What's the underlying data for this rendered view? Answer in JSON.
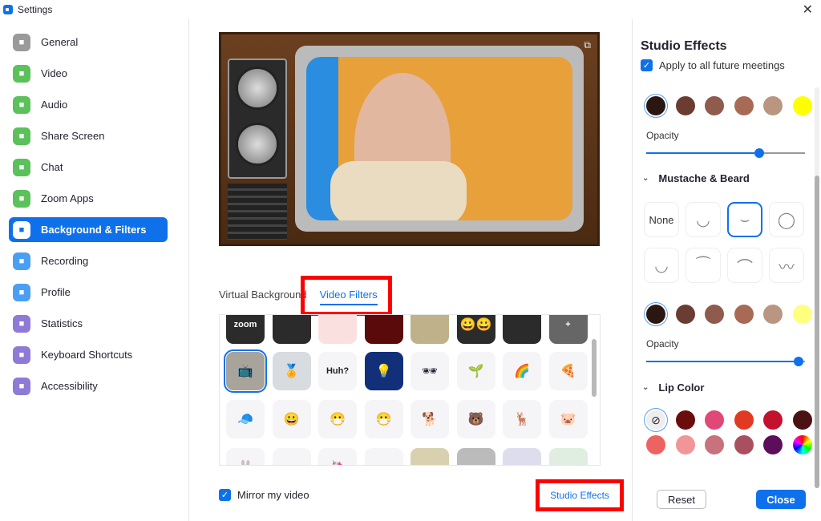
{
  "window": {
    "title": "Settings"
  },
  "sidebar": {
    "items": [
      {
        "label": "General",
        "icon": "gear-icon",
        "color": "#9a9a9a"
      },
      {
        "label": "Video",
        "icon": "video-icon",
        "color": "#5bc15b"
      },
      {
        "label": "Audio",
        "icon": "headphones-icon",
        "color": "#5bc15b"
      },
      {
        "label": "Share Screen",
        "icon": "share-screen-icon",
        "color": "#5bc15b"
      },
      {
        "label": "Chat",
        "icon": "chat-icon",
        "color": "#5bc15b"
      },
      {
        "label": "Zoom Apps",
        "icon": "apps-icon",
        "color": "#5bc15b"
      },
      {
        "label": "Background & Filters",
        "icon": "background-icon",
        "color": "#0e71eb",
        "active": true
      },
      {
        "label": "Recording",
        "icon": "recording-icon",
        "color": "#4a9ff5"
      },
      {
        "label": "Profile",
        "icon": "profile-icon",
        "color": "#4a9ff5"
      },
      {
        "label": "Statistics",
        "icon": "statistics-icon",
        "color": "#8f7ad8"
      },
      {
        "label": "Keyboard Shortcuts",
        "icon": "keyboard-icon",
        "color": "#8f7ad8"
      },
      {
        "label": "Accessibility",
        "icon": "accessibility-icon",
        "color": "#8f7ad8"
      }
    ]
  },
  "main": {
    "tabs": [
      {
        "label": "Virtual Background",
        "active": false
      },
      {
        "label": "Video Filters",
        "active": true
      }
    ],
    "filters": [
      [
        "zoom",
        "",
        "",
        "",
        "",
        "😀😀",
        "",
        "+"
      ],
      [
        "📺",
        "🏅",
        "Huh?",
        "💡",
        "🕶",
        "🌱",
        "🌈",
        "🍕"
      ],
      [
        "🧢",
        "😀",
        "😷",
        "😷",
        "🐕",
        "🐻",
        "🦌",
        "🐷"
      ],
      [
        "🐰",
        "",
        "🦄",
        "",
        "",
        "",
        "",
        ""
      ]
    ],
    "mirror_label": "Mirror my video",
    "mirror_checked": true,
    "studio_effects_label": "Studio Effects"
  },
  "panel": {
    "title": "Studio Effects",
    "apply_label": "Apply to all future meetings",
    "apply_checked": true,
    "eyebrow_colors": [
      "#2a1712",
      "#6b3d32",
      "#8e5b4d",
      "#a96a55",
      "#b89680",
      "#ffff00"
    ],
    "opacity_label": "Opacity",
    "eyebrow_opacity": 0.71,
    "beard_section": "Mustache & Beard",
    "beard_none": "None",
    "beard_colors": [
      "#2a1712",
      "#6b3d32",
      "#8e5b4d",
      "#a96a55",
      "#b89680",
      "#ffff80"
    ],
    "beard_opacity": 0.96,
    "lip_section": "Lip Color",
    "lip_colors": [
      "none",
      "#6b0d0d",
      "#e04878",
      "#e23a22",
      "#c2122e",
      "#4a1212",
      "#ef6262",
      "#f29598",
      "#c7727d",
      "#a85060",
      "#5b0f5b",
      "rainbow"
    ],
    "reset_label": "Reset",
    "close_label": "Close"
  }
}
